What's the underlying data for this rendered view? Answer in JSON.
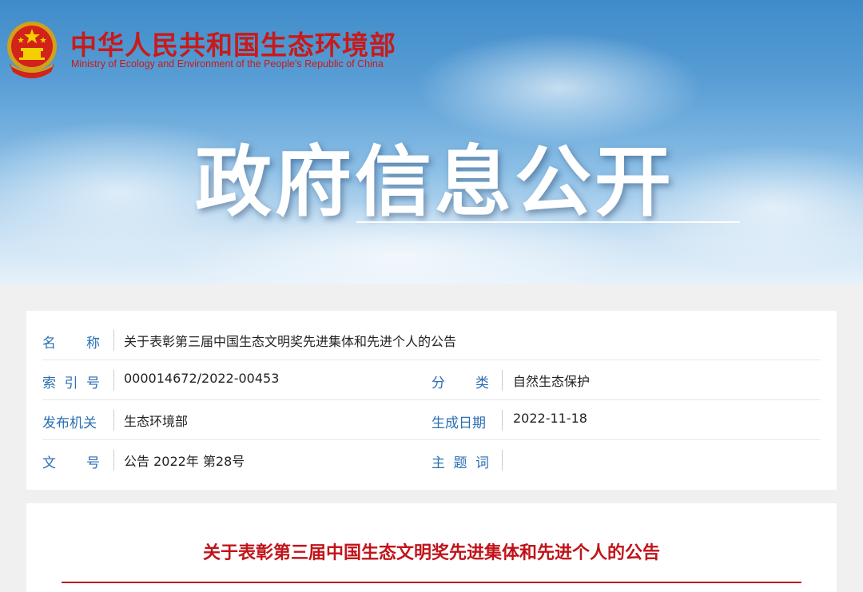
{
  "header": {
    "ministry_cn": "中华人民共和国生态环境部",
    "ministry_en": "Ministry of Ecology and Environment of the People's Republic of China",
    "emblem_icon": "national-emblem-icon",
    "hero_title": "政府信息公开"
  },
  "info": {
    "name_label": [
      "名",
      "称"
    ],
    "name_value": "关于表彰第三届中国生态文明奖先进集体和先进个人的公告",
    "index_label": [
      "索",
      "引",
      "号"
    ],
    "index_value": "000014672/2022-00453",
    "category_label": [
      "分",
      "类"
    ],
    "category_value": "自然生态保护",
    "issuer_label": "发布机关",
    "issuer_value": "生态环境部",
    "date_label": "生成日期",
    "date_value": "2022-11-18",
    "docno_label": [
      "文",
      "号"
    ],
    "docno_value": "公告 2022年 第28号",
    "keywords_label": [
      "主",
      "题",
      "词"
    ],
    "keywords_value": ""
  },
  "article": {
    "title": "关于表彰第三届中国生态文明奖先进集体和先进个人的公告"
  },
  "colors": {
    "brand_red": "#c81a1a",
    "label_blue": "#2a6fb3"
  }
}
